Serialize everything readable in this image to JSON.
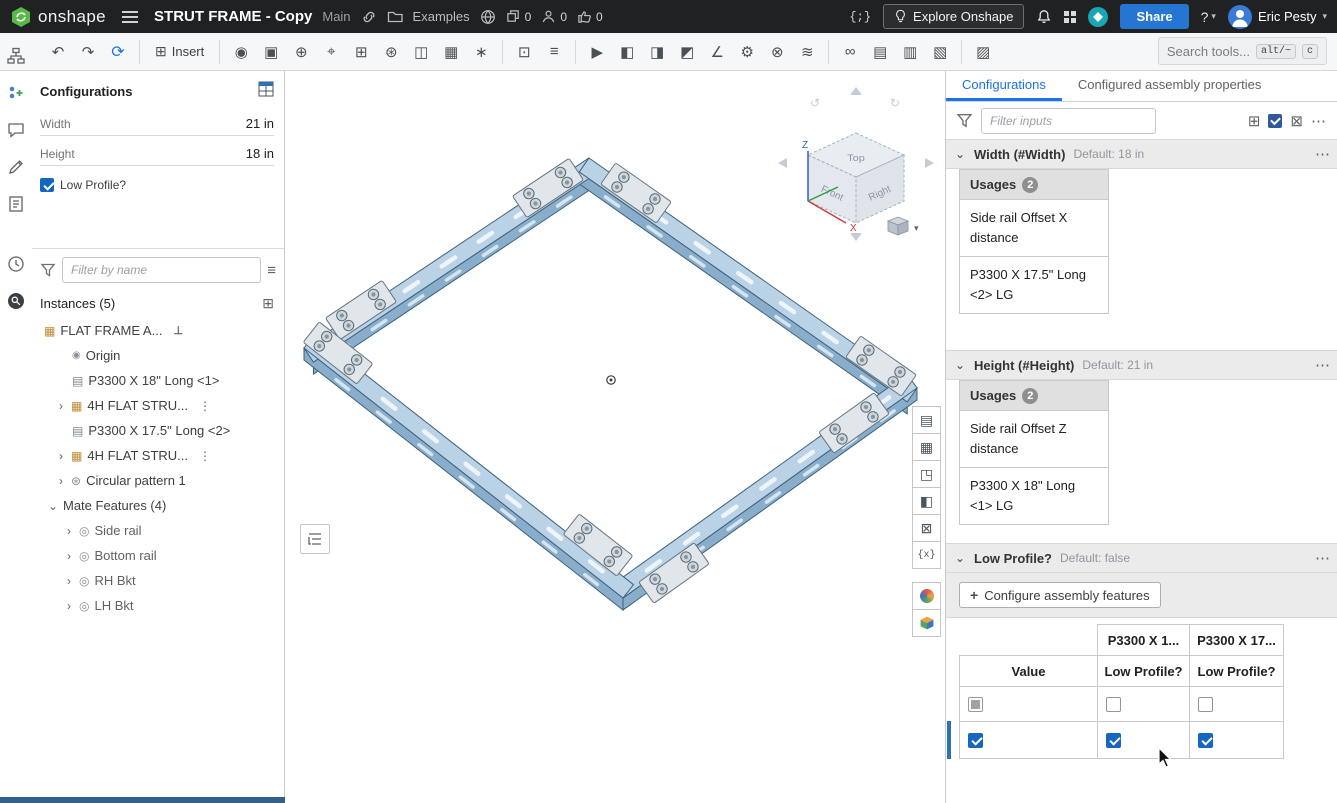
{
  "topbar": {
    "logo_text": "onshape",
    "doc_title": "STRUT FRAME - Copy",
    "workspace": "Main",
    "folder_label": "Examples",
    "stat_copies": "0",
    "stat_followers": "0",
    "stat_likes": "0",
    "explore_label": "Explore Onshape",
    "share_label": "Share",
    "user_name": "Eric Pesty"
  },
  "toolbar": {
    "insert_label": "Insert",
    "search_placeholder": "Search tools...",
    "shortcut_alt": "alt/~",
    "shortcut_c": "c",
    "icons": [
      {
        "name": "mate-icon",
        "glyph": "◉"
      },
      {
        "name": "group-icon",
        "glyph": "▣"
      },
      {
        "name": "fasten-icon",
        "glyph": "⊕"
      },
      {
        "name": "mate-connector-icon",
        "glyph": "⌖"
      },
      {
        "name": "linear-pattern-icon",
        "glyph": "⊞"
      },
      {
        "name": "circular-pattern-icon",
        "glyph": "⊛"
      },
      {
        "name": "mirror-icon",
        "glyph": "◫"
      },
      {
        "name": "replicate-icon",
        "glyph": "▦"
      },
      {
        "name": "explode-icon",
        "glyph": "∗"
      },
      {
        "name": "snapshot-icon",
        "glyph": "⊡"
      },
      {
        "name": "named-positions-icon",
        "glyph": "≡"
      },
      {
        "name": "animate-icon",
        "glyph": "▶"
      },
      {
        "name": "section-view-icon",
        "glyph": "◧"
      },
      {
        "name": "display-states-icon",
        "glyph": "◨"
      },
      {
        "name": "appearance-icon",
        "glyph": "◩"
      },
      {
        "name": "measure-icon",
        "glyph": "∠"
      },
      {
        "name": "gear-icon",
        "glyph": "⚙"
      },
      {
        "name": "sprocket-icon",
        "glyph": "⊗"
      },
      {
        "name": "belt-icon",
        "glyph": "≋"
      },
      {
        "name": "chain-icon",
        "glyph": "∞"
      },
      {
        "name": "bom-icon",
        "glyph": "▤"
      },
      {
        "name": "structure-list-icon",
        "glyph": "▥"
      },
      {
        "name": "drawing-icon",
        "glyph": "▧"
      },
      {
        "name": "publication-icon",
        "glyph": "▨"
      }
    ]
  },
  "left_panel": {
    "title": "Configurations",
    "fields": [
      {
        "label": "Width",
        "value": "21 in"
      },
      {
        "label": "Height",
        "value": "18 in"
      }
    ],
    "low_profile_label": "Low Profile?",
    "filter_placeholder": "Filter by name",
    "instances_label": "Instances (5)",
    "tree": [
      {
        "label": "FLAT FRAME A..."
      },
      {
        "label": "Origin"
      },
      {
        "label": "P3300 X 18\" Long <1>"
      },
      {
        "label": "4H FLAT STRU..."
      },
      {
        "label": "P3300 X 17.5\" Long <2>"
      },
      {
        "label": "4H FLAT STRU..."
      },
      {
        "label": "Circular pattern 1"
      },
      {
        "label": "Mate Features (4)"
      },
      {
        "label": "Side rail"
      },
      {
        "label": "Bottom rail"
      },
      {
        "label": "RH Bkt"
      },
      {
        "label": "LH Bkt"
      }
    ]
  },
  "viewport": {
    "cube_top": "Top",
    "cube_front": "Front",
    "cube_right": "Right",
    "axis_z": "Z",
    "axis_x": "X"
  },
  "right_strip": {
    "icons": [
      {
        "name": "bom-panel-icon",
        "glyph": "▤"
      },
      {
        "name": "parts-list-icon",
        "glyph": "▦"
      },
      {
        "name": "move-tree-icon",
        "glyph": "◳"
      },
      {
        "name": "section-panel-icon",
        "glyph": "◧"
      },
      {
        "name": "mate-lock-icon",
        "glyph": "⊠"
      },
      {
        "name": "variables-icon",
        "glyph": "{x}"
      }
    ]
  },
  "right_panel": {
    "tab_configurations": "Configurations",
    "tab_properties": "Configured assembly properties",
    "filter_placeholder": "Filter inputs",
    "width_section": {
      "title": "Width (#Width)",
      "default": "Default: 18 in",
      "usages_label": "Usages",
      "usages_count": "2",
      "usage_1": "Side rail Offset X distance",
      "usage_2": "P3300 X 17.5\" Long <2> LG"
    },
    "height_section": {
      "title": "Height (#Height)",
      "default": "Default: 21 in",
      "usages_label": "Usages",
      "usages_count": "2",
      "usage_1": "Side rail Offset Z distance",
      "usage_2": "P3300 X 18\" Long <1> LG"
    },
    "low_profile_section": {
      "title": "Low Profile?",
      "default": "Default: false",
      "configure_label": "Configure assembly features",
      "col_header_1": "P3300 X 1...",
      "col_header_2": "P3300 X 17...",
      "sub_header_value": "Value",
      "sub_header_lp1": "Low Profile?",
      "sub_header_lp2": "Low Profile?",
      "row1": {
        "value_state": "indeterminate",
        "lp1_state": "unchecked",
        "lp2_state": "unchecked"
      },
      "row2": {
        "value_state": "checked",
        "lp1_state": "checked",
        "lp2_state": "checked",
        "selected": true
      }
    }
  },
  "icons": {
    "chevron_right": "›",
    "chevron_down": "⌄",
    "caret_down": "▾",
    "dots_vertical": "⋮",
    "more": "⋯",
    "fix": "⊥",
    "origin": "◉",
    "part": "▤",
    "assembly": "▦",
    "pattern": "⊛",
    "mate": "◎",
    "grid": "⊞",
    "matrix": "⊠",
    "list": "≡",
    "question": "?",
    "dev": "{;}",
    "plus": "+",
    "undo": "↶",
    "redo": "↷",
    "sync": "⟳",
    "insert": "⊞",
    "rotate_left": "↺",
    "rotate_right": "↻",
    "check": "✓"
  },
  "colors": {
    "accent_blue": "#1a73e8",
    "share_blue": "#2576d2",
    "logo_green": "#57b947",
    "checkbox_blue": "#1566c0",
    "selection_blue": "#2e6fb5",
    "rail_top": "#b9d2e5",
    "rail_side": "#89aecb",
    "plate_gray": "#e1e6ea"
  }
}
